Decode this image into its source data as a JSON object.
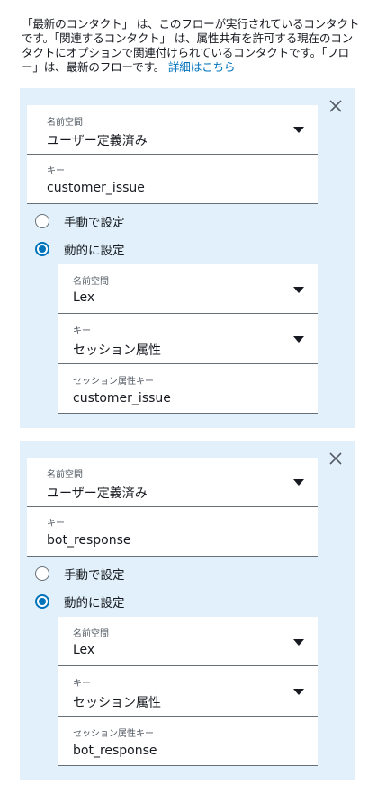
{
  "description": {
    "text": "「最新のコンタクト」 は、このフローが実行されているコンタクトです。「関連するコンタクト」 は、属性共有を許可する現在のコンタクトにオプションで関連付けられているコンタクトです。「フロー」は、最新のフローです。 ",
    "link": "詳細はこちら"
  },
  "cards": [
    {
      "namespace": {
        "label": "名前空間",
        "value": "ユーザー定義済み"
      },
      "key": {
        "label": "キー",
        "value": "customer_issue"
      },
      "radio_manual": "手動で設定",
      "radio_dynamic": "動的に設定",
      "selected": "dynamic",
      "dyn_namespace": {
        "label": "名前空間",
        "value": "Lex"
      },
      "dyn_key": {
        "label": "キー",
        "value": "セッション属性"
      },
      "session_key": {
        "label": "セッション属性キー",
        "value": "customer_issue"
      }
    },
    {
      "namespace": {
        "label": "名前空間",
        "value": "ユーザー定義済み"
      },
      "key": {
        "label": "キー",
        "value": "bot_response"
      },
      "radio_manual": "手動で設定",
      "radio_dynamic": "動的に設定",
      "selected": "dynamic",
      "dyn_namespace": {
        "label": "名前空間",
        "value": "Lex"
      },
      "dyn_key": {
        "label": "キー",
        "value": "セッション属性"
      },
      "session_key": {
        "label": "セッション属性キー",
        "value": "bot_response"
      }
    }
  ],
  "colors": {
    "card_bg": "#e1f0fa",
    "accent": "#0073bb",
    "link": "#0073bb"
  },
  "icons": {
    "close": "close-icon",
    "dropdown": "chevron-down-icon"
  }
}
